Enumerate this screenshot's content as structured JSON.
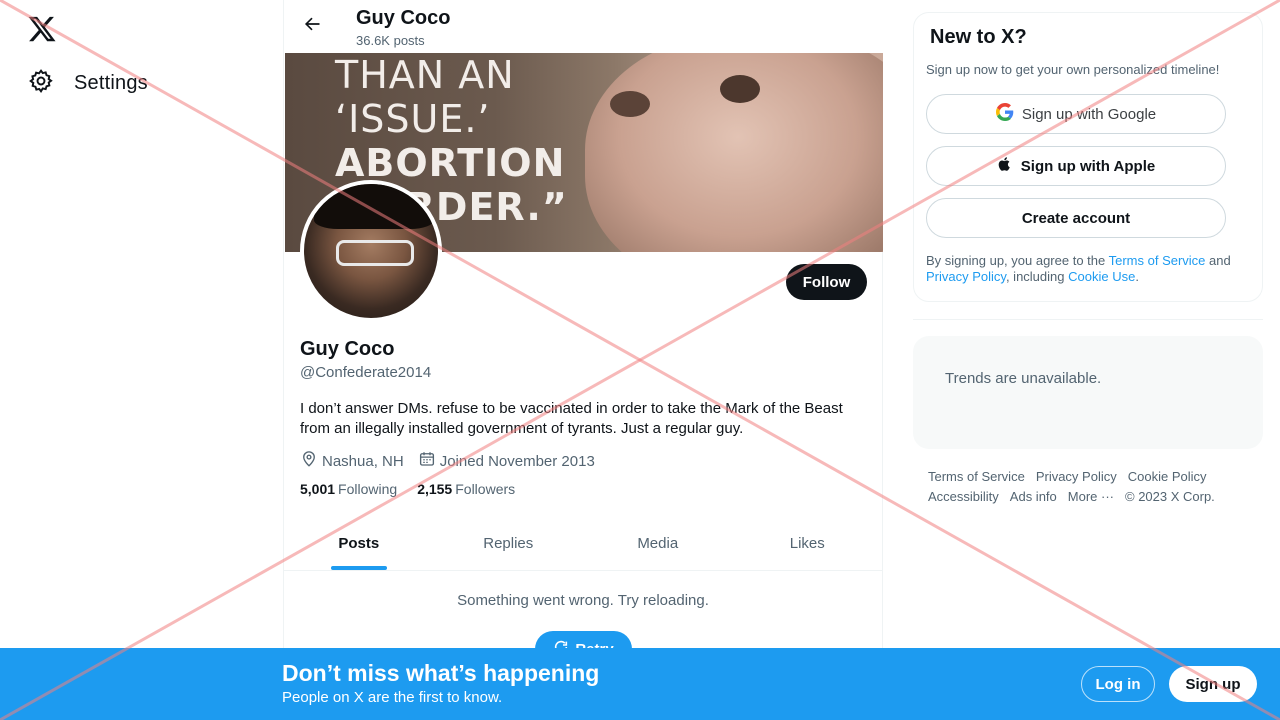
{
  "nav": {
    "settings_label": "Settings"
  },
  "header": {
    "name": "Guy Coco",
    "posts_count": "36.6K posts"
  },
  "banner": {
    "lines": [
      "THAN AN",
      "‘ISSUE.’",
      "ABORTION",
      "MURDER.”"
    ]
  },
  "profile": {
    "name": "Guy Coco",
    "handle": "@Confederate2014",
    "bio": "I don’t answer DMs. refuse to be vaccinated in order to take the Mark of the Beast from an illegally installed government of tyrants. Just a regular guy.",
    "location": "Nashua, NH",
    "joined": "Joined November 2013",
    "following_count": "5,001",
    "following_label": "Following",
    "followers_count": "2,155",
    "followers_label": "Followers",
    "follow_button": "Follow"
  },
  "tabs": [
    {
      "label": "Posts",
      "active": true
    },
    {
      "label": "Replies",
      "active": false
    },
    {
      "label": "Media",
      "active": false
    },
    {
      "label": "Likes",
      "active": false
    }
  ],
  "feed": {
    "error_message": "Something went wrong. Try reloading.",
    "retry_label": "Retry"
  },
  "signup_card": {
    "title": "New to X?",
    "subtitle": "Sign up now to get your own personalized timeline!",
    "google_label": "Sign up with Google",
    "apple_label": "Sign up with Apple",
    "create_label": "Create account",
    "terms_prefix": "By signing up, you agree to the ",
    "terms_link": "Terms of Service",
    "terms_and": " and ",
    "privacy_link": "Privacy Policy",
    "terms_including": ", including ",
    "cookie_link": "Cookie Use",
    "terms_end": "."
  },
  "trends": {
    "message": "Trends are unavailable."
  },
  "footer": {
    "row1": [
      "Terms of Service",
      "Privacy Policy",
      "Cookie Policy"
    ],
    "row2": [
      "Accessibility",
      "Ads info",
      "More ···",
      "© 2023 X Corp."
    ]
  },
  "bottom_bar": {
    "title": "Don’t miss what’s happening",
    "subtitle": "People on X are the first to know.",
    "login_label": "Log in",
    "signup_label": "Sign up"
  },
  "colors": {
    "accent": "#1d9bf0",
    "text_primary": "#0f1419",
    "text_secondary": "#536471",
    "overlay_x": "#f4a6a6"
  }
}
